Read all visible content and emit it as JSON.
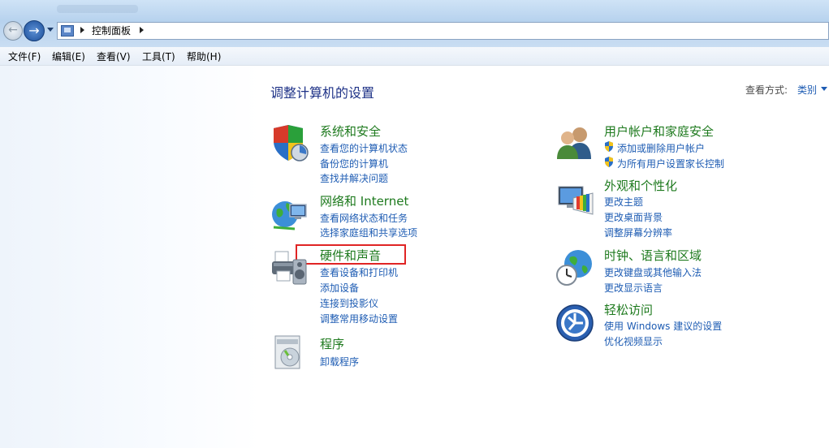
{
  "nav": {
    "breadcrumb": "控制面板"
  },
  "menu": [
    "文件(F)",
    "编辑(E)",
    "查看(V)",
    "工具(T)",
    "帮助(H)"
  ],
  "main": {
    "title": "调整计算机的设置",
    "view_label": "查看方式:",
    "view_value": "类别"
  },
  "categories": {
    "system_security": {
      "title": "系统和安全",
      "links": [
        "查看您的计算机状态",
        "备份您的计算机",
        "查找并解决问题"
      ]
    },
    "network": {
      "title": "网络和 Internet",
      "links": [
        "查看网络状态和任务",
        "选择家庭组和共享选项"
      ]
    },
    "hardware_sound": {
      "title": "硬件和声音",
      "links": [
        "查看设备和打印机",
        "添加设备",
        "连接到投影仪",
        "调整常用移动设置"
      ]
    },
    "programs": {
      "title": "程序",
      "links": [
        "卸载程序"
      ]
    },
    "user_accounts": {
      "title": "用户帐户和家庭安全",
      "links": [
        "添加或删除用户帐户",
        "为所有用户设置家长控制"
      ]
    },
    "appearance": {
      "title": "外观和个性化",
      "links": [
        "更改主题",
        "更改桌面背景",
        "调整屏幕分辨率"
      ]
    },
    "clock_region": {
      "title": "时钟、语言和区域",
      "links": [
        "更改键盘或其他输入法",
        "更改显示语言"
      ]
    },
    "ease_access": {
      "title": "轻松访问",
      "links": [
        "使用 Windows 建议的设置",
        "优化视频显示"
      ]
    }
  },
  "colors": {
    "category_title": "#1e7a1e",
    "link": "#1e5cb3",
    "highlight_box": "#e02424"
  }
}
